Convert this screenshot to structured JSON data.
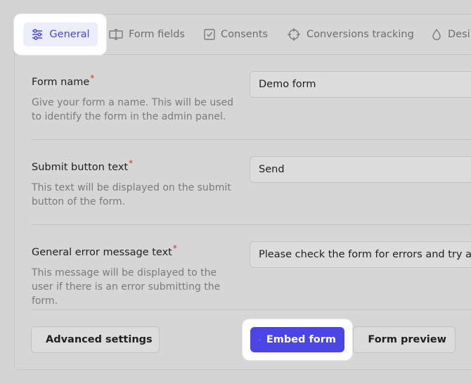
{
  "tabs": [
    {
      "label": "General",
      "icon": "sliders-icon",
      "active": true
    },
    {
      "label": "Form fields",
      "icon": "text-field-icon"
    },
    {
      "label": "Consents",
      "icon": "checkbox-icon"
    },
    {
      "label": "Conversions tracking",
      "icon": "crosshair-icon"
    },
    {
      "label": "Desi",
      "icon": "droplet-icon"
    }
  ],
  "fields": [
    {
      "label": "Form name",
      "required_mark": "*",
      "description": "Give your form a name. This will be used to identify the form in the admin panel.",
      "value": "Demo form"
    },
    {
      "label": "Submit button text",
      "required_mark": "*",
      "description": "This text will be displayed on the submit button of the form.",
      "value": "Send"
    },
    {
      "label": "General error message text",
      "required_mark": "*",
      "description": "This message will be displayed to the user if there is an error submitting the form.",
      "value": "Please check the form for errors and try agai"
    }
  ],
  "footer": {
    "advanced_label": "Advanced settings",
    "embed_label": "Embed form",
    "preview_label": "Form preview"
  },
  "colors": {
    "accent": "#4c45e6",
    "required": "#d63030"
  }
}
